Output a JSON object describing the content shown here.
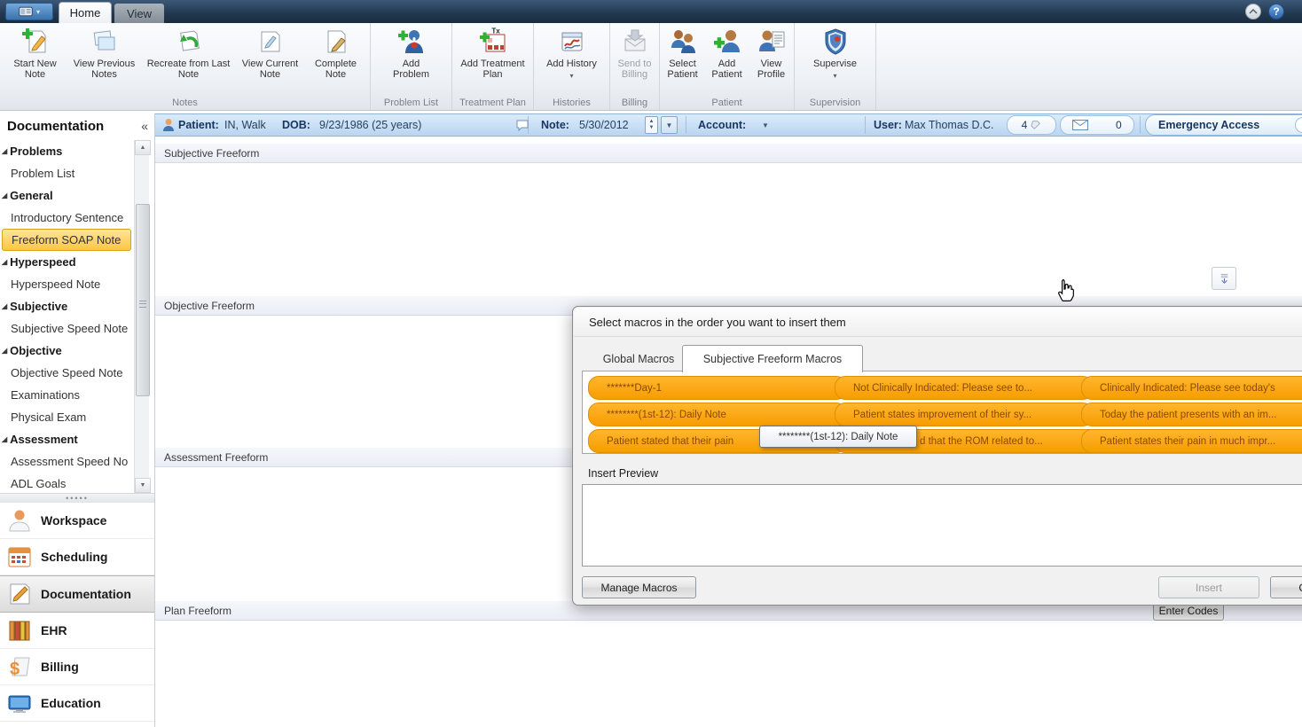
{
  "app": {
    "tabs": {
      "home": "Home",
      "view": "View"
    },
    "help": "?"
  },
  "ribbon": {
    "groups": [
      {
        "label": "Notes",
        "buttons": [
          "Start New Note",
          "View Previous Notes",
          "Recreate from Last Note",
          "View Current Note",
          "Complete Note"
        ]
      },
      {
        "label": "Problem List",
        "buttons": [
          "Add Problem"
        ]
      },
      {
        "label": "Treatment Plan",
        "buttons": [
          "Add Treatment Plan"
        ]
      },
      {
        "label": "Histories",
        "buttons": [
          "Add History"
        ]
      },
      {
        "label": "Billing",
        "buttons": [
          "Send to Billing"
        ]
      },
      {
        "label": "Patient",
        "buttons": [
          "Select Patient",
          "Add Patient",
          "View Profile"
        ]
      },
      {
        "label": "Supervision",
        "buttons": [
          "Supervise"
        ]
      }
    ]
  },
  "patientbar": {
    "patient_label": "Patient:",
    "patient_value": "IN, Walk",
    "dob_label": "DOB:",
    "dob_value": "9/23/1986 (25 years)",
    "note_label": "Note:",
    "note_value": "5/30/2012",
    "account_label": "Account:",
    "user_label": "User:",
    "user_value": "Max Thomas D.C.",
    "alerts_count": "4",
    "messages_count": "0",
    "emergency_access_label": "Emergency Access"
  },
  "sidebar": {
    "title": "Documentation",
    "collapse_glyph": "«",
    "tree": [
      {
        "label": "Problems"
      },
      {
        "label": "Problem List"
      },
      {
        "label": "General"
      },
      {
        "label": "Introductory Sentence"
      },
      {
        "label": "Freeform SOAP Note"
      },
      {
        "label": "Hyperspeed"
      },
      {
        "label": "Hyperspeed Note"
      },
      {
        "label": "Subjective"
      },
      {
        "label": "Subjective Speed Note"
      },
      {
        "label": "Objective"
      },
      {
        "label": "Objective Speed Note"
      },
      {
        "label": "Examinations"
      },
      {
        "label": "Physical Exam"
      },
      {
        "label": "Assessment"
      },
      {
        "label": "Assessment Speed No"
      },
      {
        "label": "ADL Goals"
      }
    ],
    "nav": [
      {
        "label": "Workspace"
      },
      {
        "label": "Scheduling"
      },
      {
        "label": "Documentation"
      },
      {
        "label": "EHR"
      },
      {
        "label": "Billing"
      },
      {
        "label": "Education"
      }
    ]
  },
  "main": {
    "sections": [
      {
        "label": "Subjective Freeform"
      },
      {
        "label": "Objective Freeform"
      },
      {
        "label": "Assessment Freeform"
      },
      {
        "label": "Plan Freeform"
      }
    ],
    "enter_codes_label": "Enter Codes"
  },
  "dialog": {
    "title": "Select macros in the order you want to insert them",
    "tabs": [
      {
        "label": "Global Macros"
      },
      {
        "label": "Subjective Freeform Macros"
      }
    ],
    "macros": [
      "*******Day-1",
      "Not Clinically Indicated:  Please see to...",
      "Clinically Indicated:  Please see today's",
      "********(1st-12): Daily Note",
      "Patient states improvement of their sy...",
      "Today the patient presents with an im...",
      "Patient stated that their pain",
      "d that the ROM related to...",
      "Patient states their pain in much impr..."
    ],
    "tooltip": "********(1st-12): Daily Note",
    "insert_preview_label": "Insert Preview",
    "manage_macros_label": "Manage Macros",
    "insert_label": "Insert",
    "cancel_label": "Cancel"
  },
  "colors": {
    "macro_orange": "#f79d00",
    "selection_yellow": "#fbc742",
    "patientbar_blue": "#b9d5f0",
    "titlebar_navy": "#243a52"
  }
}
